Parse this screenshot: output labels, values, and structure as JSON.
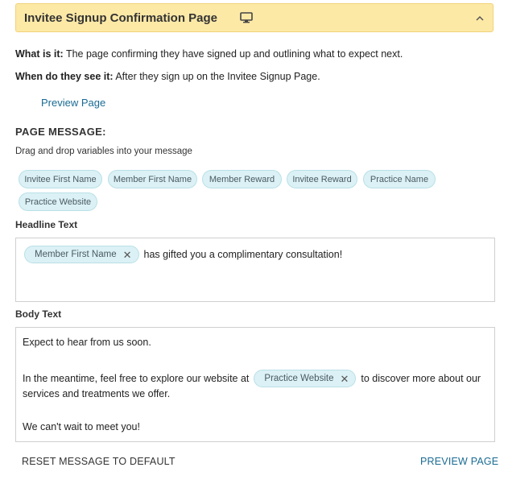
{
  "panel": {
    "title": "Invitee Signup Confirmation Page",
    "icons": {
      "device": "monitor-icon",
      "collapse": "chevron-up-icon"
    },
    "header_bg": "#fde9a6"
  },
  "meta": {
    "what_label": "What is it:",
    "what_text": " The page confirming they have signed up and outlining what to expect next.",
    "when_label": "When do they see it:",
    "when_text": " After they sign up on the Invitee Signup Page."
  },
  "preview_link": "Preview Page",
  "page_message": {
    "title": "PAGE MESSAGE:",
    "help": "Drag and drop variables into your message"
  },
  "variables": [
    "Invitee First Name",
    "Member First Name",
    "Member Reward",
    "Invitee Reward",
    "Practice Name",
    "Practice Website"
  ],
  "headline": {
    "label": "Headline Text",
    "token": "Member First Name",
    "text": "has gifted you a complimentary consultation!"
  },
  "body": {
    "label": "Body Text",
    "line1": "Expect to hear from us soon.",
    "line2_before": "In the meantime, feel free to explore our website at",
    "line2_token": "Practice Website",
    "line2_after": "to discover more about our",
    "line3": "services and treatments we offer.",
    "line4": "We can't wait to meet you!"
  },
  "footer": {
    "reset": "RESET MESSAGE TO DEFAULT",
    "preview": "PREVIEW PAGE"
  },
  "colors": {
    "link": "#1a6b93",
    "chip_bg": "#dbf1f5"
  }
}
